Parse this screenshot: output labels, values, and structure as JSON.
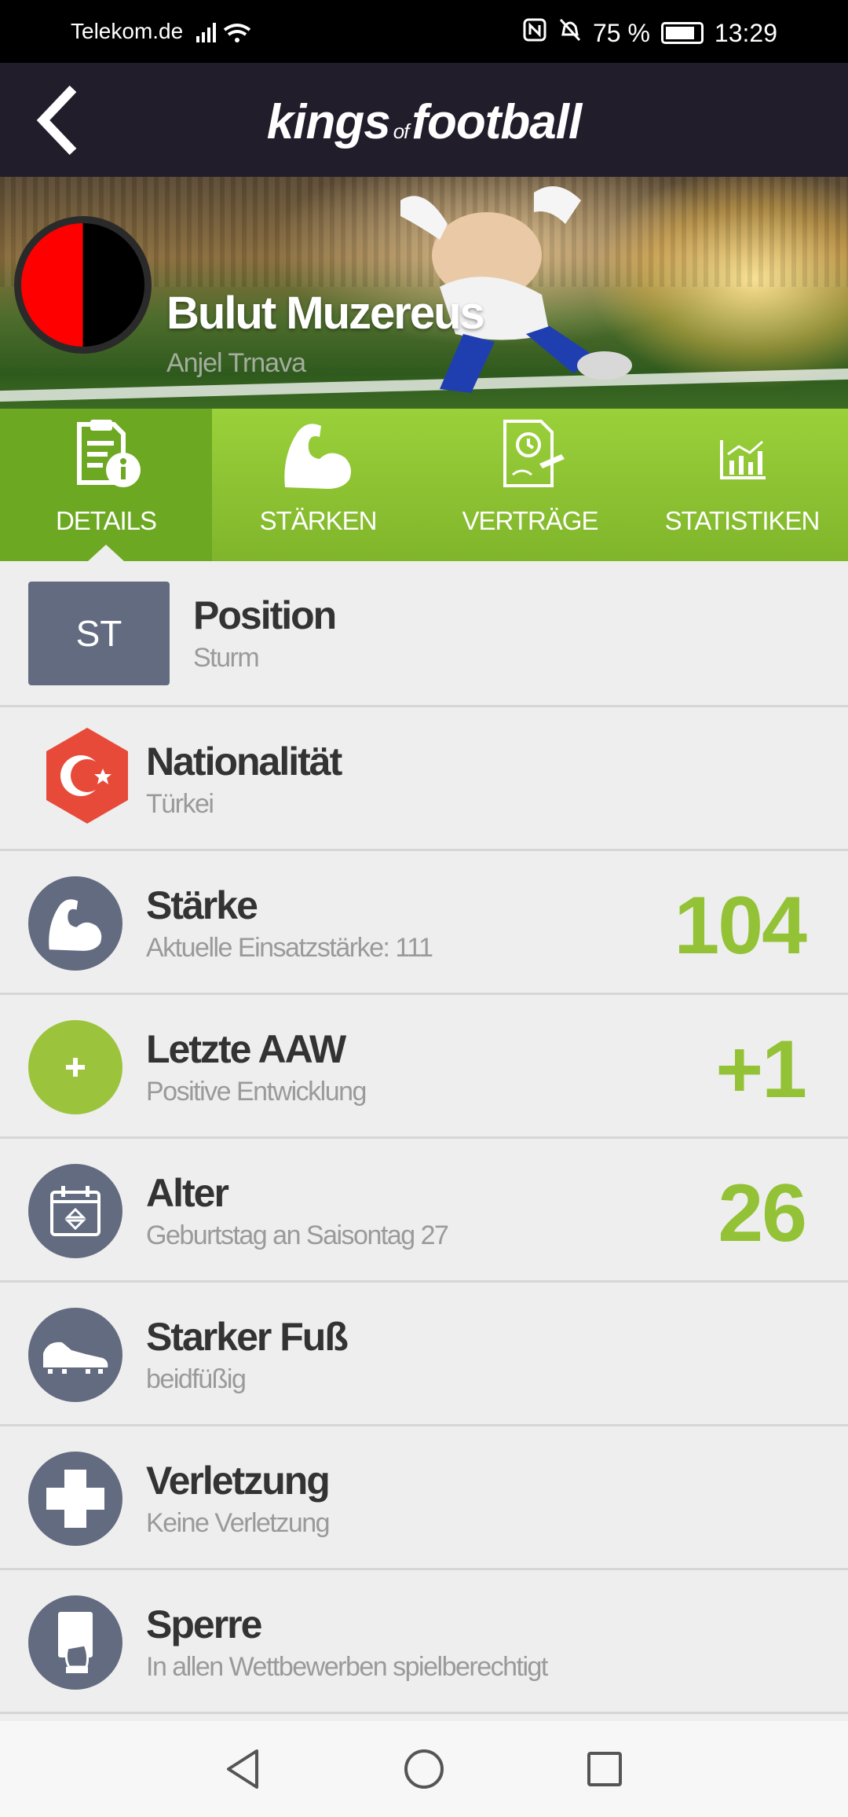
{
  "status_bar": {
    "carrier": "Telekom.de",
    "battery": "75 %",
    "time": "13:29"
  },
  "app_bar": {
    "brand_left": "kings",
    "brand_of": "of",
    "brand_right": "football"
  },
  "hero": {
    "player_name": "Bulut Muzereus",
    "club_name": "Anjel Trnava",
    "club_colors": [
      "#ff0000",
      "#000000"
    ]
  },
  "tabs": [
    {
      "label": "DETAILS",
      "icon": "details-icon",
      "active": true
    },
    {
      "label": "STÄRKEN",
      "icon": "muscle-icon",
      "active": false
    },
    {
      "label": "VERTRÄGE",
      "icon": "contract-icon",
      "active": false
    },
    {
      "label": "STATISTIKEN",
      "icon": "chart-icon",
      "active": false
    }
  ],
  "details": {
    "position": {
      "badge": "ST",
      "title": "Position",
      "sub": "Sturm"
    },
    "nationality": {
      "title": "Nationalität",
      "sub": "Türkei",
      "icon": "turkey-flag-icon"
    },
    "strength": {
      "title": "Stärke",
      "sub": "Aktuelle Einsatzstärke: 111",
      "value": "104",
      "icon": "muscle-icon"
    },
    "last_aaw": {
      "title": "Letzte AAW",
      "sub": "Positive Entwicklung",
      "value": "+1",
      "icon": "plus-icon"
    },
    "age": {
      "title": "Alter",
      "sub": "Geburtstag an Saisontag 27",
      "value": "26",
      "icon": "calendar-icon"
    },
    "foot": {
      "title": "Starker Fuß",
      "sub": "beidfüßig",
      "icon": "football-boot-icon"
    },
    "injury": {
      "title": "Verletzung",
      "sub": "Keine Verletzung",
      "icon": "medical-cross-icon"
    },
    "suspension": {
      "title": "Sperre",
      "sub": "In allen Wettbewerben spielberechtigt",
      "icon": "referee-card-icon"
    }
  },
  "colors": {
    "accent_green": "#93c236",
    "tab_green": "#80b52b",
    "icon_gray": "#626b80",
    "app_bar": "#221d2b"
  }
}
